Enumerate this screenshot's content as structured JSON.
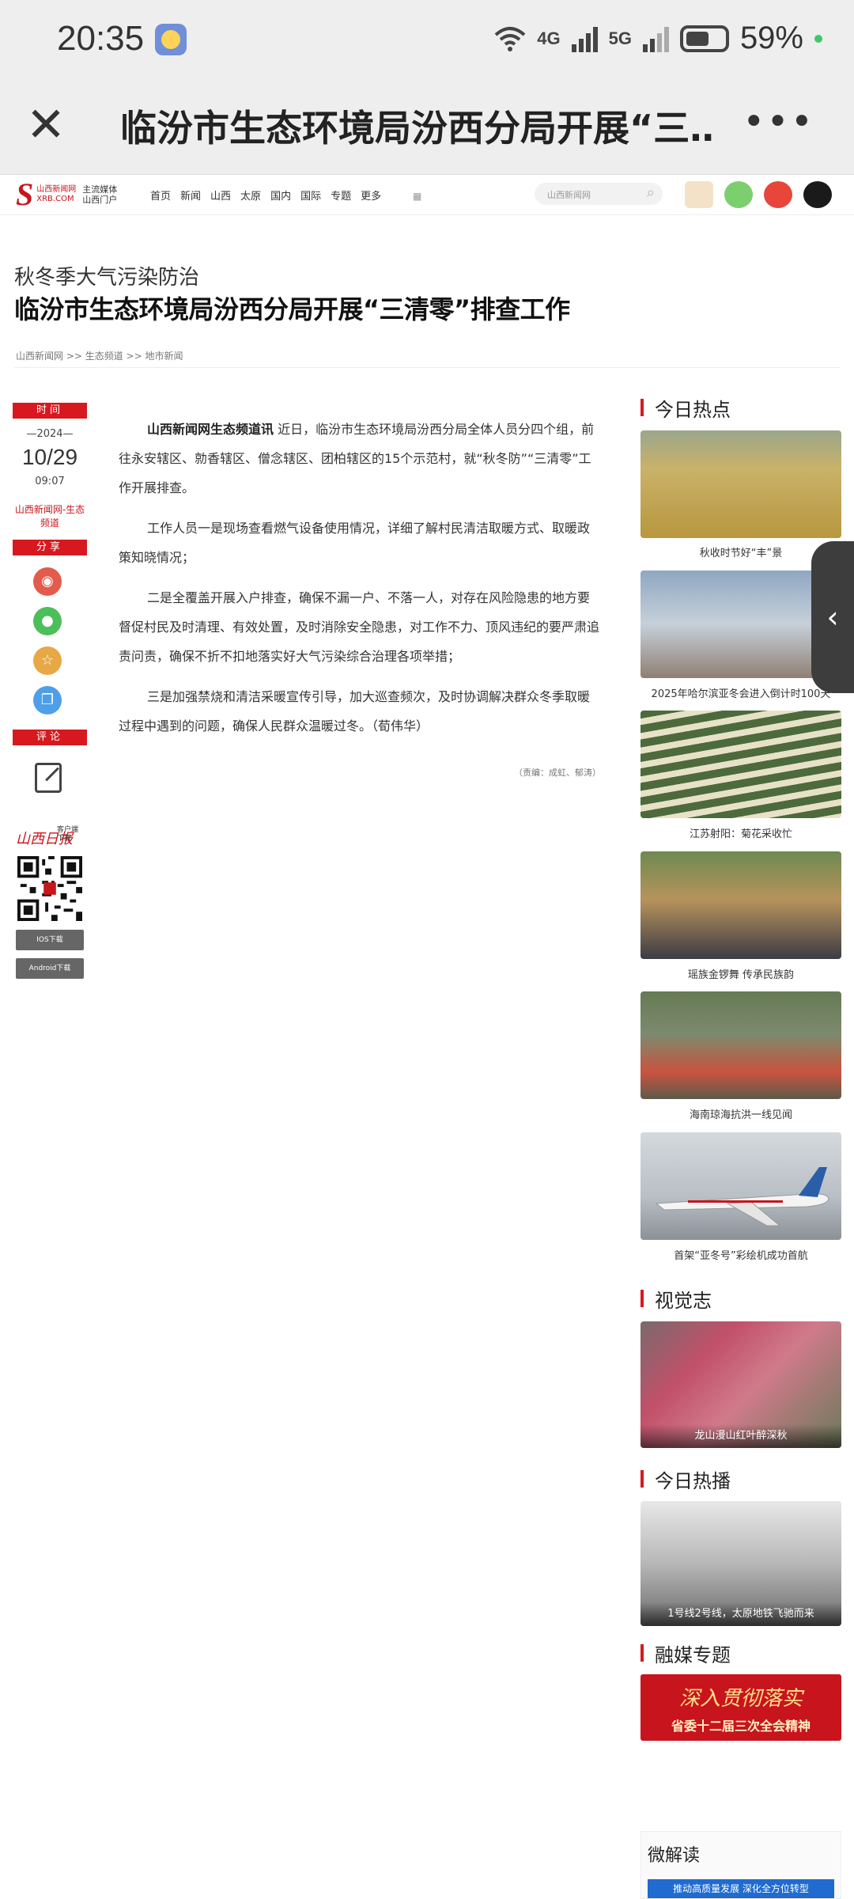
{
  "status_bar": {
    "time": "20:35",
    "network_4g": "4G",
    "network_5g": "5G",
    "battery_percent": "59%"
  },
  "nav": {
    "close_icon": "close-icon",
    "title": "临汾市生态环境局汾西分局开展“三…",
    "more_icon": "more-icon"
  },
  "site": {
    "logo_letter": "S",
    "logo_text": "山西新闻网",
    "logo_domain": "XRB.COM",
    "slogan_line1": "主流媒体",
    "slogan_line2": "山西门户",
    "menu": [
      "首页",
      "新闻",
      "山西",
      "太原",
      "国内",
      "国际",
      "专题",
      "更多"
    ],
    "search_placeholder": "山西新闻网",
    "colors": {
      "brand_red": "#c8161d",
      "accent_red": "#d7191f"
    }
  },
  "article": {
    "kicker": "秋冬季大气污染防治",
    "headline": "临汾市生态环境局汾西分局开展“三清零”排查工作",
    "breadcrumb": "山西新闻网 >> 生态频道 >> 地市新闻",
    "time_label": "时间",
    "year": "—2024—",
    "date": "10/29",
    "time": "09:07",
    "source": "山西新闻网-生态频道",
    "share_label": "分享",
    "comment_label": "评论",
    "lead": "山西新闻网生态频道讯",
    "p1": " 近日，临汾市生态环境局汾西分局全体人员分四个组，前往永安辖区、勍香辖区、僧念辖区、团柏辖区的15个示范村，就“秋冬防”“三清零”工作开展排查。",
    "p2": "工作人员一是现场查看燃气设备使用情况，详细了解村民清洁取暖方式、取暖政策知晓情况；",
    "p3": "二是全覆盖开展入户排查，确保不漏一户、不落一人，对存在风险隐患的地方要督促村民及时清理、有效处置，及时消除安全隐患，对工作不力、顶风违纪的要严肃追责问责，确保不折不扣地落实好大气污染综合治理各项举措；",
    "p4": "三是加强禁烧和清洁采暖宣传引导，加大巡查频次，及时协调解决群众冬季取暖过程中遇到的问题，确保人民群众温暖过冬。（荀伟华）",
    "editor": "（责编：成虹、郁涛）"
  },
  "app_promo": {
    "paper_name": "山西日报",
    "sub_line1": "客户端",
    "sub_line2": "下载",
    "ios": "IOS下载",
    "android": "Android下载"
  },
  "sidebar": {
    "hot_title": "今日热点",
    "hot_items": [
      {
        "caption": "秋收时节好“丰”景",
        "color": "#b9a25a"
      },
      {
        "caption": "2025年哈尔滨亚冬会进入倒计时100天",
        "color": "#7f8fa6"
      },
      {
        "caption": "江苏射阳：菊花采收忙",
        "color": "#5c7a46"
      },
      {
        "caption": "瑶族金锣舞 传承民族韵",
        "color": "#8c6a48"
      },
      {
        "caption": "海南琼海抗洪一线见闻",
        "color": "#5e6e4a"
      },
      {
        "caption": "首架“亚冬号”彩绘机成功首航",
        "color": "#9aa3ab"
      }
    ],
    "visual_title": "视觉志",
    "visual_caption": "龙山漫山红叶醉深秋",
    "broadcast_title": "今日热播",
    "broadcast_caption": "1号线2号线，太原地铁飞驰而来",
    "media_title": "融媒专题",
    "banner_line1": "深入贯彻落实",
    "banner_line2": "省委十二届三次全会精神",
    "micro_title": "微解读",
    "micro_strip": "推动高质量发展 深化全方位转型"
  }
}
